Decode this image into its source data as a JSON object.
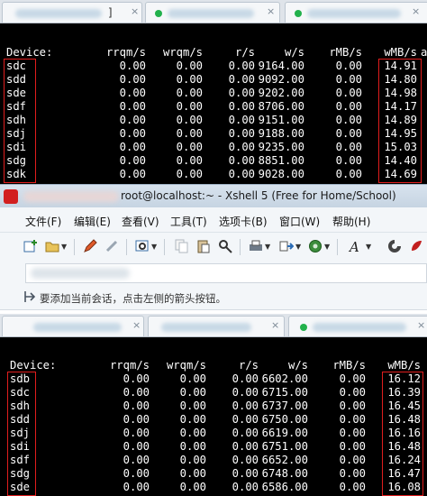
{
  "top_tabs": [
    {
      "label": "]",
      "close": "×"
    },
    {
      "label": "",
      "close": "×"
    },
    {
      "label": "",
      "close": "×"
    }
  ],
  "window": {
    "title": "root@localhost:~ - Xshell 5 (Free for Home/School)"
  },
  "menu": [
    "文件(F)",
    "编辑(E)",
    "查看(V)",
    "工具(T)",
    "选项卡(B)",
    "窗口(W)",
    "帮助(H)"
  ],
  "toolbar_icons": [
    "new-session-icon",
    "open-folder-icon",
    "pen-icon",
    "disconnect-icon",
    "settings-icon",
    "copy-icon",
    "paste-icon",
    "find-icon",
    "print-icon",
    "transfer-icon",
    "globe-icon",
    "font-icon",
    "xftp-icon",
    "xshell-icon"
  ],
  "hint": {
    "text": "要添加当前会话，点击左侧的箭头按钮。"
  },
  "bottom_tabs": [
    {
      "label": "",
      "close": "×"
    },
    {
      "label": "",
      "close": "×"
    },
    {
      "label": "",
      "close": "×"
    }
  ],
  "top_terminal": {
    "headers": [
      "Device:",
      "rrqm/s",
      "wrqm/s",
      "r/s",
      "w/s",
      "rMB/s",
      "wMB/s",
      "a"
    ],
    "rows": [
      [
        "sdc",
        "0.00",
        "0.00",
        "0.00",
        "9164.00",
        "0.00",
        "14.91"
      ],
      [
        "sdd",
        "0.00",
        "0.00",
        "0.00",
        "9092.00",
        "0.00",
        "14.80"
      ],
      [
        "sde",
        "0.00",
        "0.00",
        "0.00",
        "9202.00",
        "0.00",
        "14.98"
      ],
      [
        "sdf",
        "0.00",
        "0.00",
        "0.00",
        "8706.00",
        "0.00",
        "14.17"
      ],
      [
        "sdh",
        "0.00",
        "0.00",
        "0.00",
        "9151.00",
        "0.00",
        "14.89"
      ],
      [
        "sdj",
        "0.00",
        "0.00",
        "0.00",
        "9188.00",
        "0.00",
        "14.95"
      ],
      [
        "sdi",
        "0.00",
        "0.00",
        "0.00",
        "9235.00",
        "0.00",
        "15.03"
      ],
      [
        "sdg",
        "0.00",
        "0.00",
        "0.00",
        "8851.00",
        "0.00",
        "14.40"
      ],
      [
        "sdk",
        "0.00",
        "0.00",
        "0.00",
        "9028.00",
        "0.00",
        "14.69"
      ]
    ]
  },
  "bottom_terminal": {
    "headers": [
      "Device:",
      "rrqm/s",
      "wrqm/s",
      "r/s",
      "w/s",
      "rMB/s",
      "wMB/s"
    ],
    "rows": [
      [
        "sdb",
        "0.00",
        "0.00",
        "0.00",
        "6602.00",
        "0.00",
        "16.12"
      ],
      [
        "sdc",
        "0.00",
        "0.00",
        "0.00",
        "6715.00",
        "0.00",
        "16.39"
      ],
      [
        "sdh",
        "0.00",
        "0.00",
        "0.00",
        "6737.00",
        "0.00",
        "16.45"
      ],
      [
        "sdd",
        "0.00",
        "0.00",
        "0.00",
        "6750.00",
        "0.00",
        "16.48"
      ],
      [
        "sdj",
        "0.00",
        "0.00",
        "0.00",
        "6619.00",
        "0.00",
        "16.16"
      ],
      [
        "sdi",
        "0.00",
        "0.00",
        "0.00",
        "6751.00",
        "0.00",
        "16.48"
      ],
      [
        "sdf",
        "0.00",
        "0.00",
        "0.00",
        "6652.00",
        "0.00",
        "16.24"
      ],
      [
        "sdg",
        "0.00",
        "0.00",
        "0.00",
        "6748.00",
        "0.00",
        "16.47"
      ],
      [
        "sde",
        "0.00",
        "0.00",
        "0.00",
        "6586.00",
        "0.00",
        "16.08"
      ]
    ]
  },
  "colors": {
    "terminal_bg": "#000000",
    "terminal_fg": "#ffffff",
    "highlight_box": "#e11d1d",
    "session_dot": "#22b14c",
    "app_icon": "#d21f1f"
  }
}
